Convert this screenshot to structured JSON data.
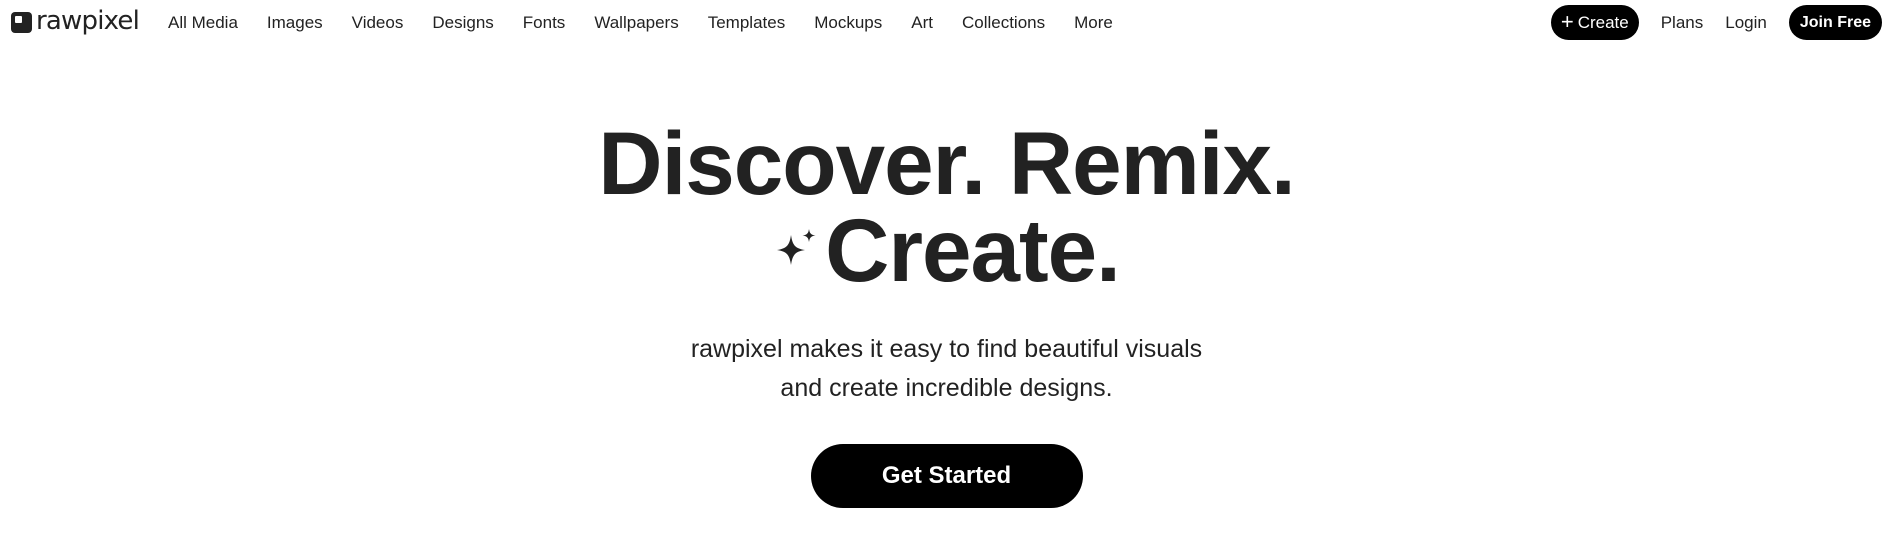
{
  "brand": {
    "logo_text": "rawpixel",
    "logo_icon": "rawpixel-square-logo"
  },
  "nav": {
    "links": [
      "All Media",
      "Images",
      "Videos",
      "Designs",
      "Fonts",
      "Wallpapers",
      "Templates",
      "Mockups",
      "Art",
      "Collections",
      "More"
    ],
    "create_label": "Create",
    "create_icon": "plus-icon",
    "plans_label": "Plans",
    "login_label": "Login",
    "join_label": "Join Free"
  },
  "hero": {
    "headline_line1": "Discover. Remix.",
    "headline_line2": "Create.",
    "sparkle_icon": "sparkle-icon",
    "subtext_line1": "rawpixel makes it easy to find beautiful visuals",
    "subtext_line2": "and create incredible designs.",
    "cta_label": "Get Started"
  },
  "colors": {
    "text": "#222222",
    "button_bg": "#000000",
    "button_text": "#ffffff",
    "background": "#ffffff"
  }
}
